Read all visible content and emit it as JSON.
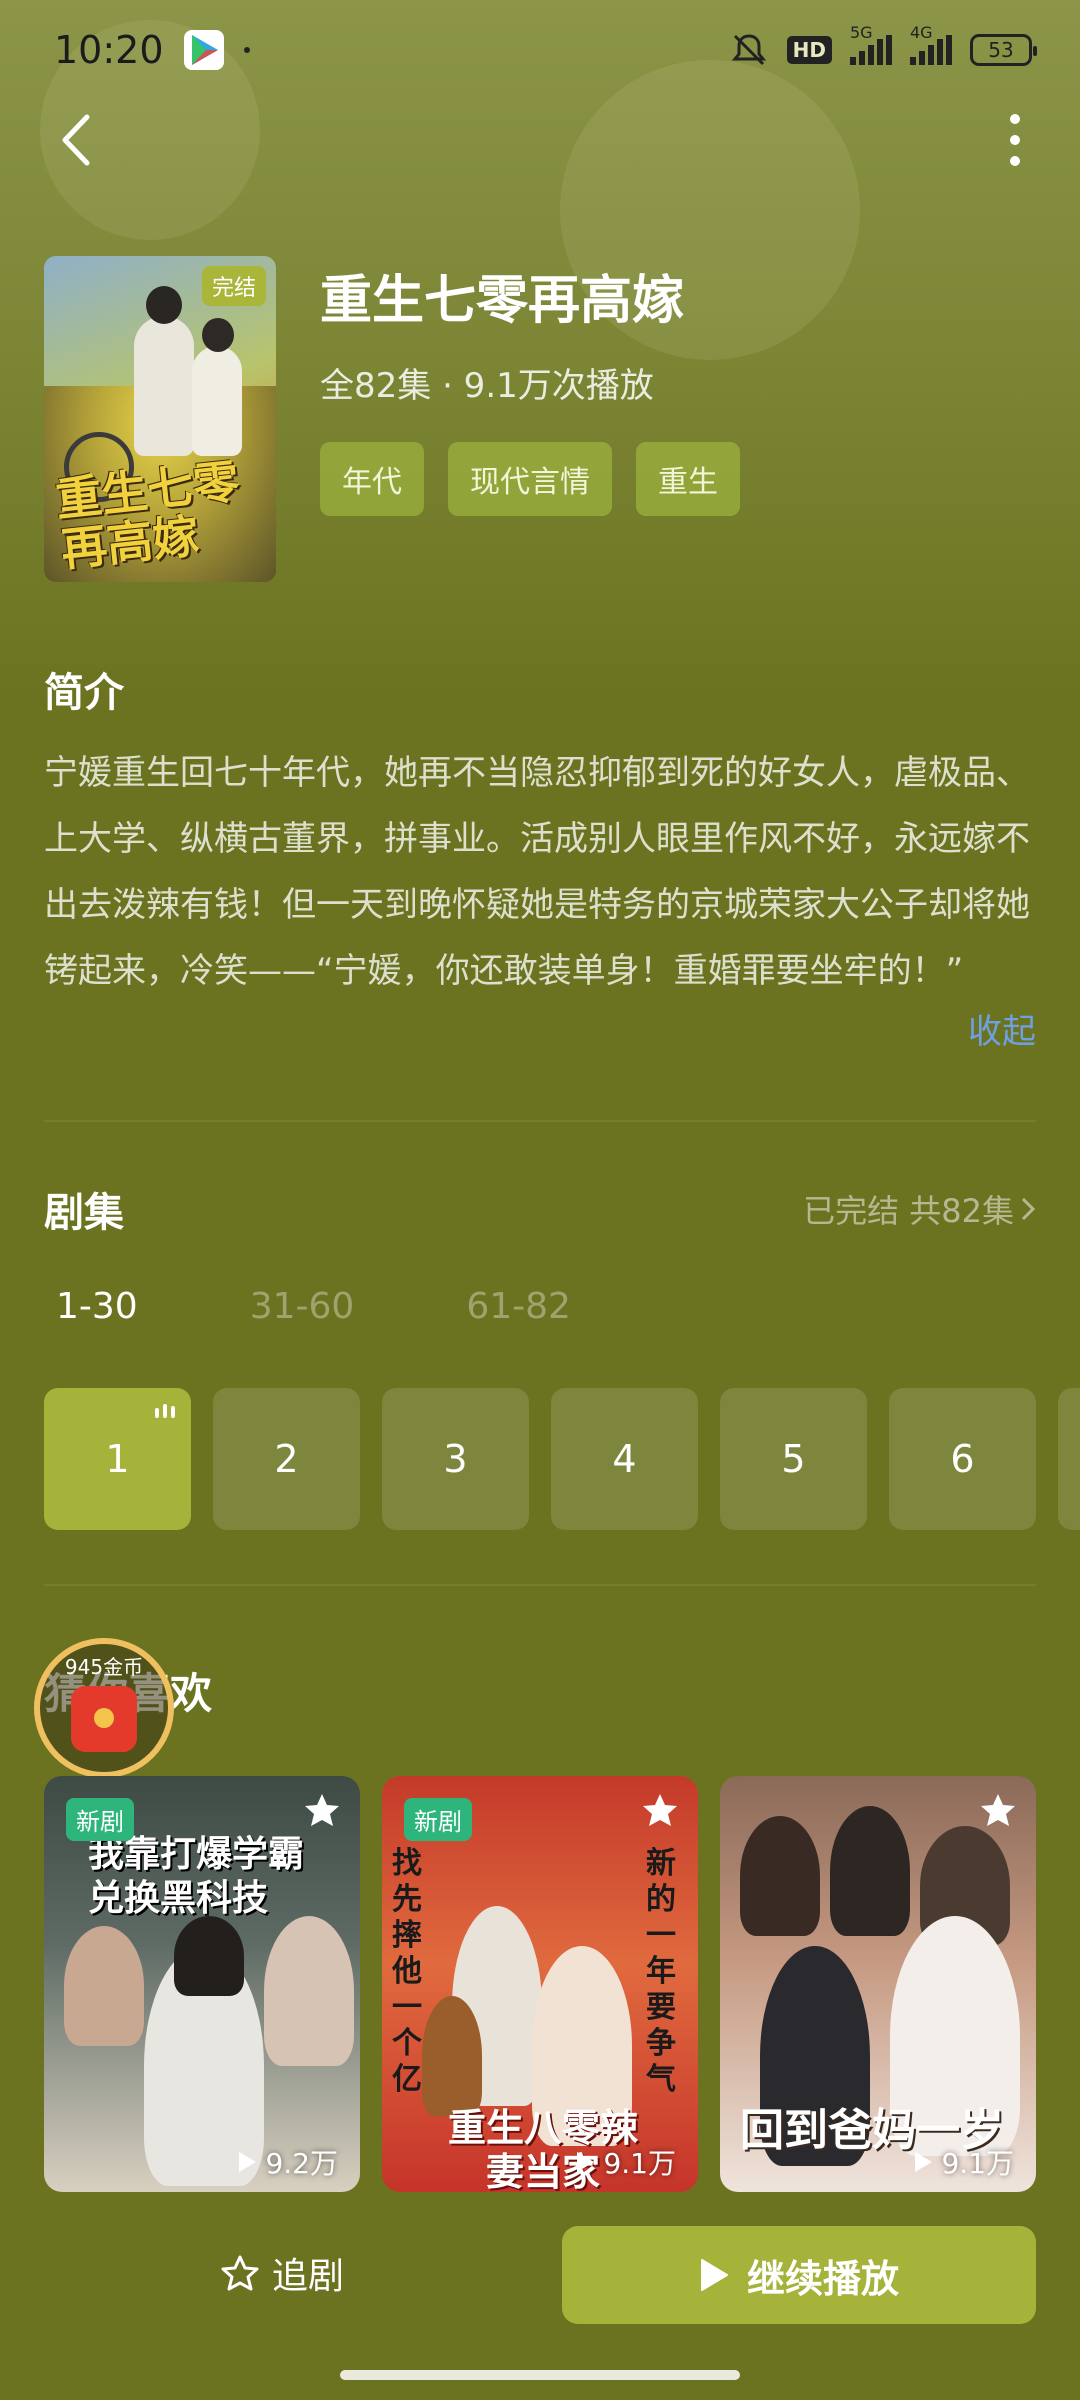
{
  "status_bar": {
    "time": "10:20",
    "hd": "HD",
    "net1": "5G",
    "net2": "4G",
    "battery": "53"
  },
  "show": {
    "title": "重生七零再高嫁",
    "meta": "全82集 · 9.1万次播放",
    "status_badge": "完结",
    "cover_title": "重生七零再高嫁",
    "tags": [
      "年代",
      "现代言情",
      "重生"
    ]
  },
  "intro": {
    "heading": "简介",
    "text": "宁媛重生回七十年代，她再不当隐忍抑郁到死的好女人，虐极品、上大学、纵横古董界，拼事业。活成别人眼里作风不好，永远嫁不出去泼辣有钱！但一天到晚怀疑她是特务的京城荣家大公子却将她铐起来，冷笑——“宁媛，你还敢装单身！重婚罪要坐牢的！”",
    "collapse_label": "收起"
  },
  "episodes": {
    "heading": "剧集",
    "summary": "已完结 共82集",
    "ranges": [
      "1-30",
      "31-60",
      "61-82"
    ],
    "items": [
      "1",
      "2",
      "3",
      "4",
      "5",
      "6"
    ]
  },
  "recommend": {
    "heading": "猜你喜欢",
    "coin_text": "945金币",
    "cards": [
      {
        "badge": "新剧",
        "poster_text": "我靠打爆学霸兑换黑科技",
        "plays": "9.2万"
      },
      {
        "badge": "新剧",
        "poster_text": "重生八零辣妻当家",
        "plays": "9.1万"
      },
      {
        "badge": "",
        "poster_text": "回到爸妈一岁",
        "plays": "9.1万"
      }
    ]
  },
  "bottom": {
    "follow_label": "追剧",
    "continue_label": "继续播放"
  },
  "colors": {
    "background": "#6b7320",
    "accent": "#a6b33a",
    "link": "#6fa0e0",
    "new_badge": "#2db57c"
  }
}
